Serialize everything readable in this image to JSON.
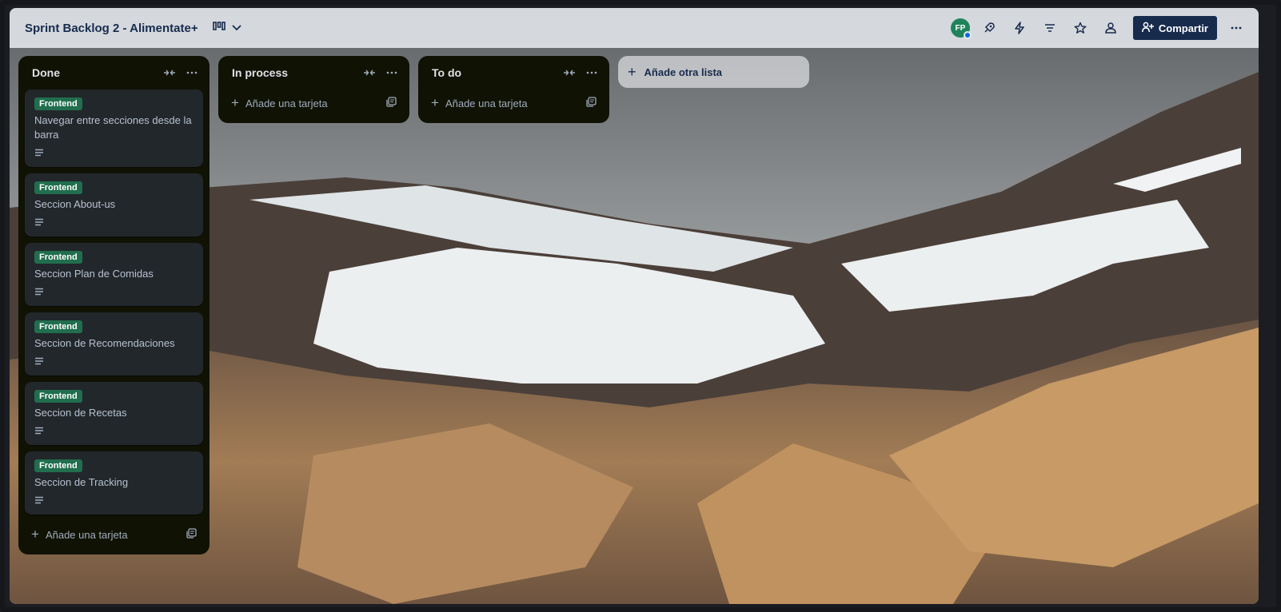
{
  "header": {
    "title": "Sprint Backlog 2 - Alimentate+",
    "avatar_initials": "FP",
    "share_label": "Compartir",
    "icons": [
      "board-view-icon",
      "chevron-down-icon",
      "rocket-icon",
      "lightning-icon",
      "filter-icon",
      "star-icon",
      "people-icon",
      "more-icon"
    ]
  },
  "lists": [
    {
      "title": "Done",
      "cards": [
        {
          "label": "Frontend",
          "title": "Navegar entre secciones desde la barra"
        },
        {
          "label": "Frontend",
          "title": "Seccion About-us"
        },
        {
          "label": "Frontend",
          "title": "Seccion Plan de Comidas"
        },
        {
          "label": "Frontend",
          "title": "Seccion de Recomendaciones"
        },
        {
          "label": "Frontend",
          "title": "Seccion de Recetas"
        },
        {
          "label": "Frontend",
          "title": "Seccion de Tracking"
        }
      ],
      "add_card": "Añade una tarjeta"
    },
    {
      "title": "In process",
      "cards": [],
      "add_card": "Añade una tarjeta"
    },
    {
      "title": "To do",
      "cards": [],
      "add_card": "Añade una tarjeta"
    }
  ],
  "add_list": "Añade otra lista",
  "colors": {
    "label_green": "#216e4e",
    "list_bg": "#101204",
    "card_bg": "#22272b",
    "share_bg": "#172b4d"
  }
}
